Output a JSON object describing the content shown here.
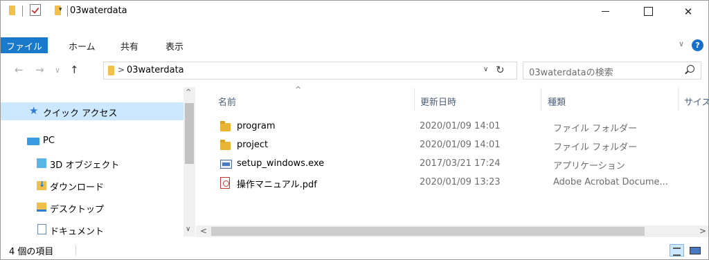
{
  "window": {
    "title": "03waterdata",
    "quick_access_dropdown": "▾",
    "close_glyph": "✕"
  },
  "ribbon": {
    "tabs": [
      {
        "label": "ファイル",
        "selected": true
      },
      {
        "label": "ホーム"
      },
      {
        "label": "共有"
      },
      {
        "label": "表示"
      }
    ],
    "expand_glyph": "∨",
    "help_glyph": "?"
  },
  "nav": {
    "back": "←",
    "forward": "→",
    "recent": "∨",
    "up": "↑",
    "address_separator": ">",
    "address_path": "03waterdata",
    "address_dropdown": "∨",
    "refresh": "↻",
    "search_placeholder": "03waterdataの検索"
  },
  "sidebar": {
    "items": [
      {
        "label": "クイック アクセス",
        "icon": "star-icon",
        "selected": true
      },
      {
        "label": "PC",
        "icon": "pc-icon"
      },
      {
        "label": "3D オブジェクト",
        "icon": "3d-objects-icon"
      },
      {
        "label": "ダウンロード",
        "icon": "downloads-icon"
      },
      {
        "label": "デスクトップ",
        "icon": "desktop-icon"
      },
      {
        "label": "ドキュメント",
        "icon": "documents-icon"
      }
    ],
    "scroll_up": "^",
    "scroll_down": "∨"
  },
  "file_list": {
    "columns": [
      "名前",
      "更新日時",
      "種類",
      "サイズ"
    ],
    "sort_indicator": "^",
    "rows": [
      {
        "name": "program",
        "date": "2020/01/09 14:01",
        "type": "ファイル フォルダー",
        "icon": "folder-icon"
      },
      {
        "name": "project",
        "date": "2020/01/09 14:01",
        "type": "ファイル フォルダー",
        "icon": "folder-icon"
      },
      {
        "name": "setup_windows.exe",
        "date": "2017/03/21 17:24",
        "type": "アプリケーション",
        "icon": "exe-icon"
      },
      {
        "name": "操作マニュアル.pdf",
        "date": "2020/01/09 13:23",
        "type": "Adobe Acrobat Docume...",
        "icon": "pdf-icon"
      }
    ],
    "hscroll_left": "<",
    "hscroll_right": ">"
  },
  "status": {
    "item_count": "4 個の項目"
  },
  "colors": {
    "accent": "#1979ca",
    "selection": "#cce8ff",
    "folder": "#e8b536"
  }
}
